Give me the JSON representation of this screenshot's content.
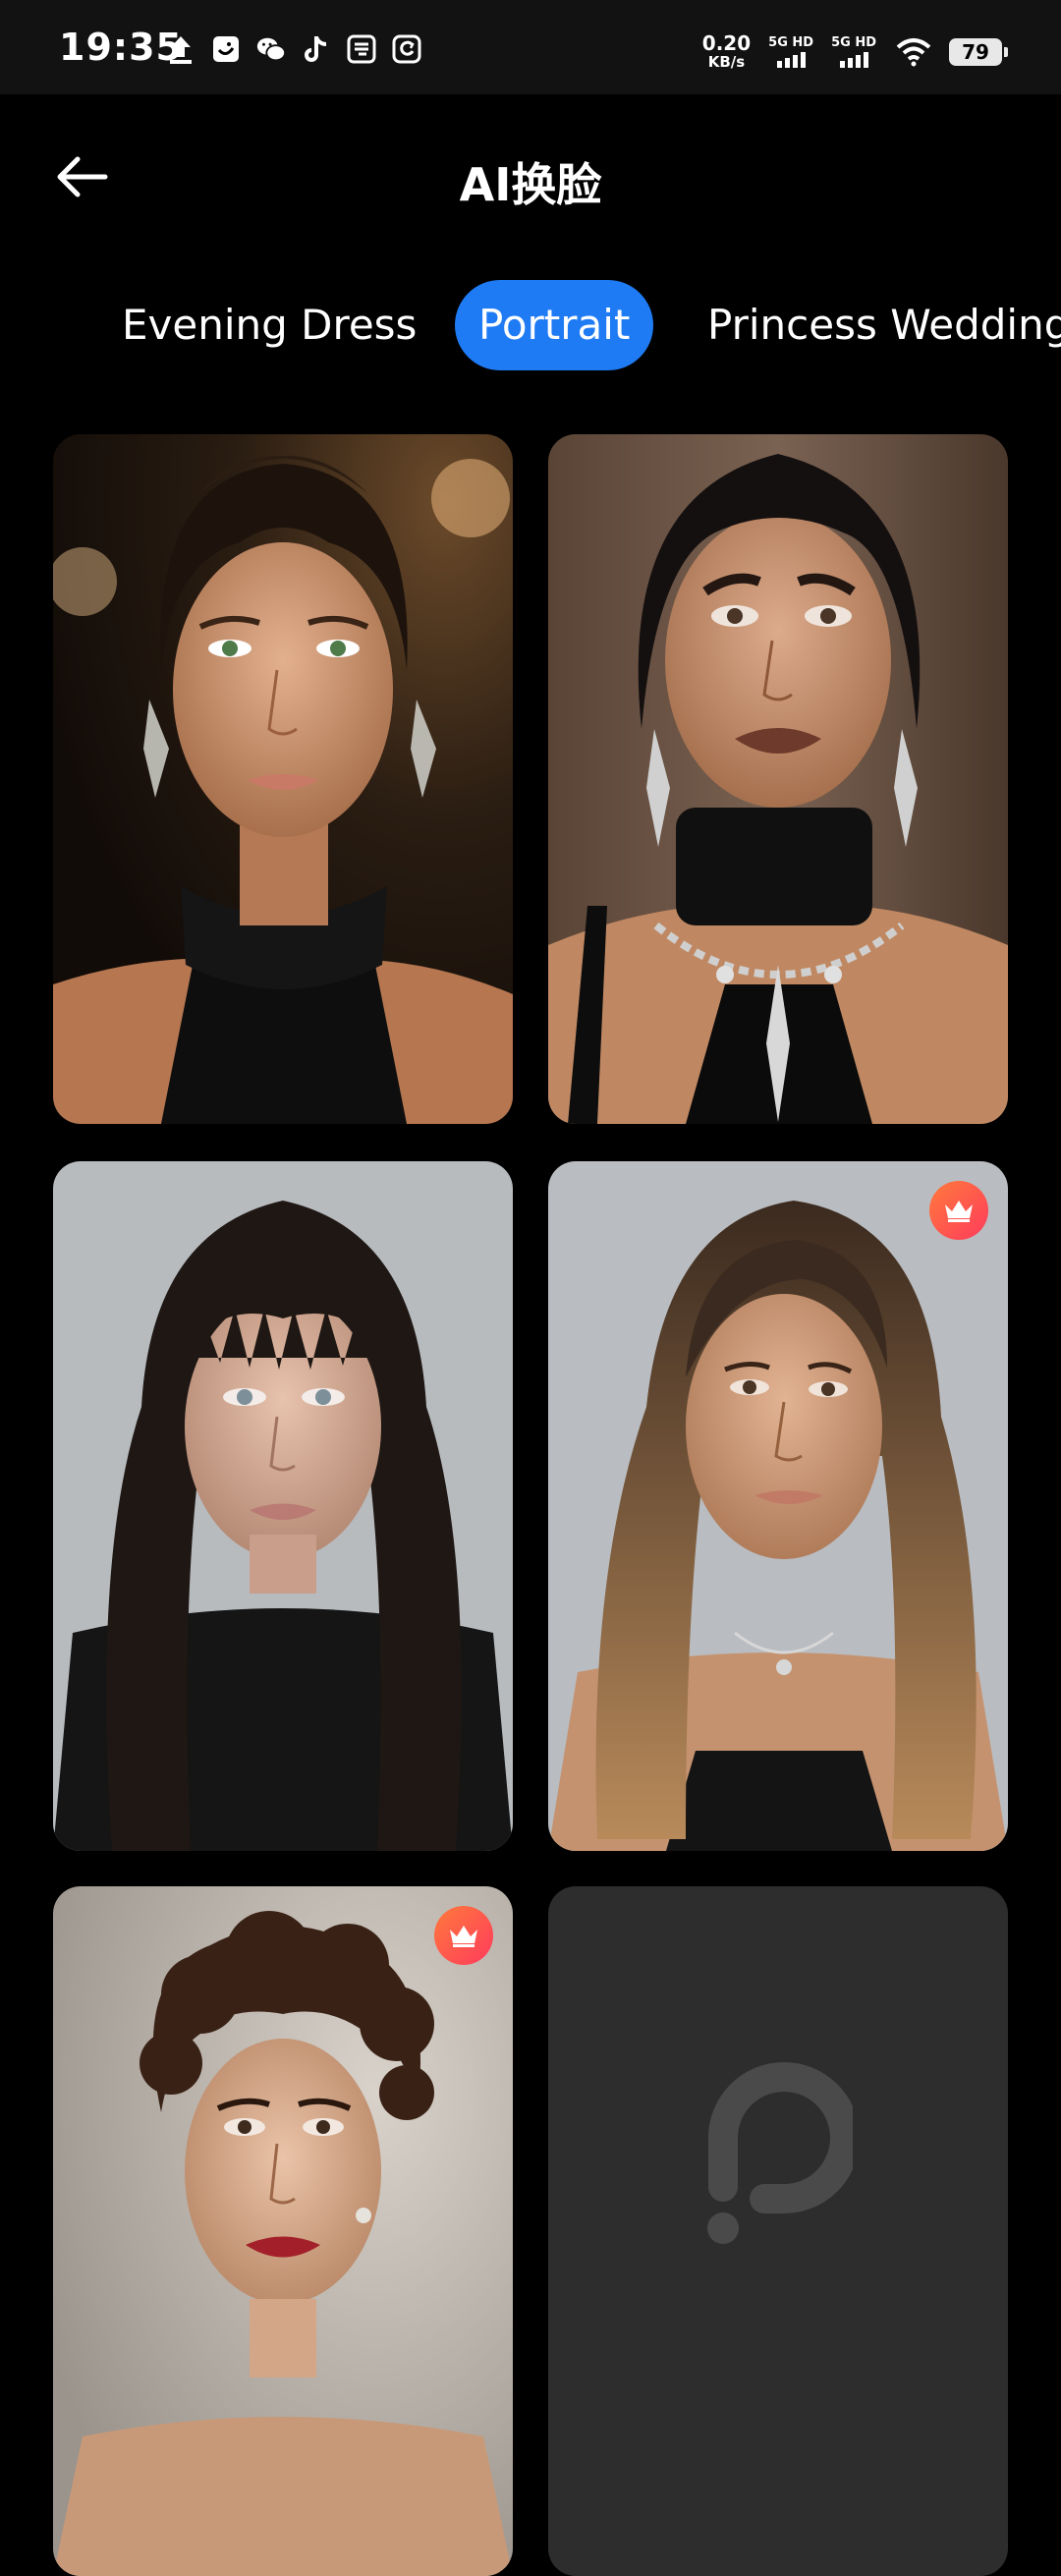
{
  "status_bar": {
    "time": "19:35",
    "net_speed_value": "0.20",
    "net_speed_unit": "KB/s",
    "sim1_label": "5G HD",
    "sim2_label": "5G HD",
    "battery": "79"
  },
  "header": {
    "title": "AI换脸"
  },
  "tabs": [
    {
      "label": "Evening Dress",
      "active": false
    },
    {
      "label": "Portrait",
      "active": true
    },
    {
      "label": "Princess Wedding",
      "active": false
    }
  ],
  "colors": {
    "accent": "#1f7bf4",
    "background": "#000000",
    "card_placeholder": "#2d2d2d",
    "premium_badge": "#ff4b55"
  },
  "grid": {
    "cards": [
      {
        "premium": false,
        "loaded": true
      },
      {
        "premium": false,
        "loaded": true
      },
      {
        "premium": false,
        "loaded": true
      },
      {
        "premium": true,
        "loaded": true
      },
      {
        "premium": true,
        "loaded": true
      },
      {
        "premium": false,
        "loaded": false
      }
    ]
  }
}
